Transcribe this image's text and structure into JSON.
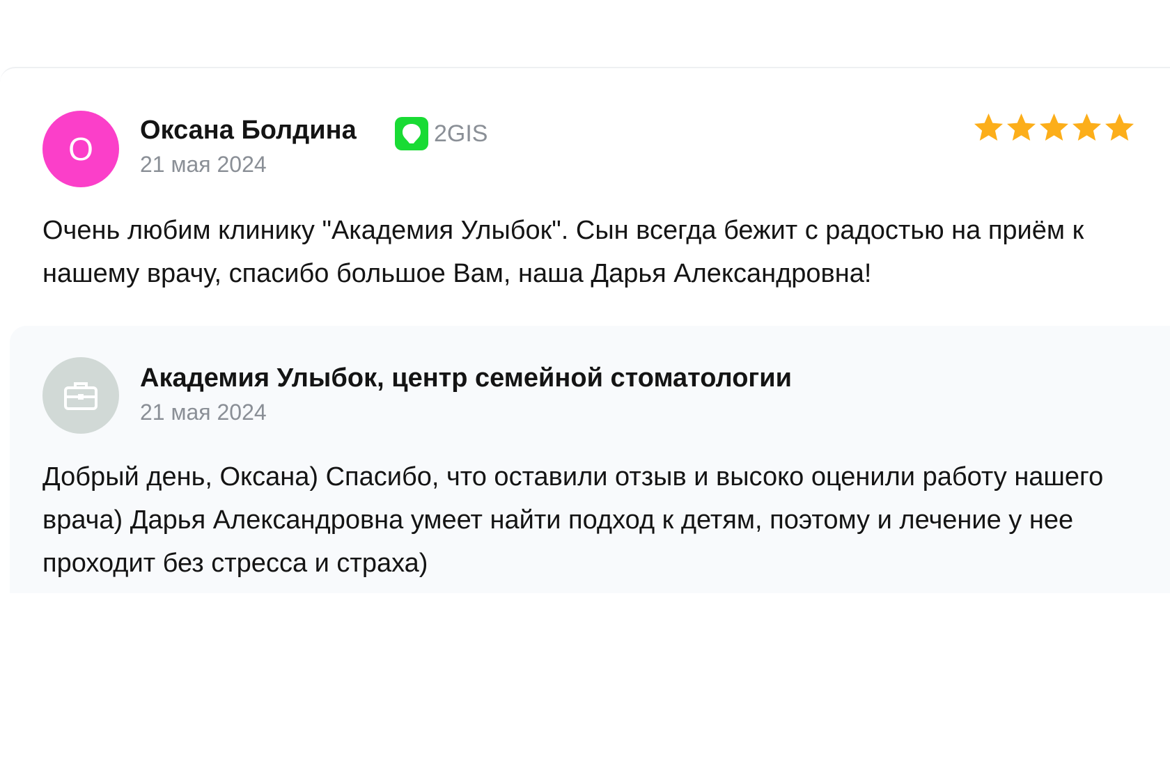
{
  "review": {
    "author_initial": "О",
    "author_name": "Оксана Болдина",
    "source_label": "2GIS",
    "source_icon": "2gis-icon",
    "source_color": "#19db34",
    "date": "21 мая 2024",
    "rating": 5,
    "rating_max": 5,
    "star_color": "#fcae1a",
    "text": "Очень любим клинику \"Академия Улыбок\". Сын всегда бежит с радостью на приём к нашему врачу, спасибо большое Вам, наша Дарья Александровна!"
  },
  "reply": {
    "org_icon": "briefcase-icon",
    "org_name": "Академия Улыбок, центр семейной стоматологии",
    "date": "21 мая 2024",
    "text": "Добрый день, Оксана) Спасибо, что оставили отзыв и высоко оценили работу нашего врача) Дарья Александровна умеет найти подход к детям, поэтому и лечение у нее проходит без стресса и страха)"
  },
  "colors": {
    "avatar_author": "#fb3fc9",
    "avatar_org": "#d1d9d6",
    "reply_background": "#f8fafc",
    "muted_text": "#8a8f96"
  }
}
